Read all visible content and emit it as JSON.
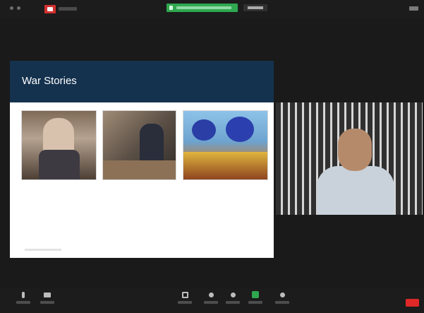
{
  "slide": {
    "title": "War Stories",
    "captions": [
      "",
      "",
      ""
    ]
  },
  "toolbar": {
    "left_tools": [
      "mic-icon",
      "video-camera-icon"
    ],
    "center_tools": [
      "participants-icon",
      "chat-icon",
      "reactions-icon",
      "share-screen-icon",
      "record-icon"
    ],
    "end_button_color": "#e02828"
  },
  "colors": {
    "slide_header": "#14324e",
    "share_banner": "#2fa84f",
    "app_background": "#1a1a1a"
  }
}
